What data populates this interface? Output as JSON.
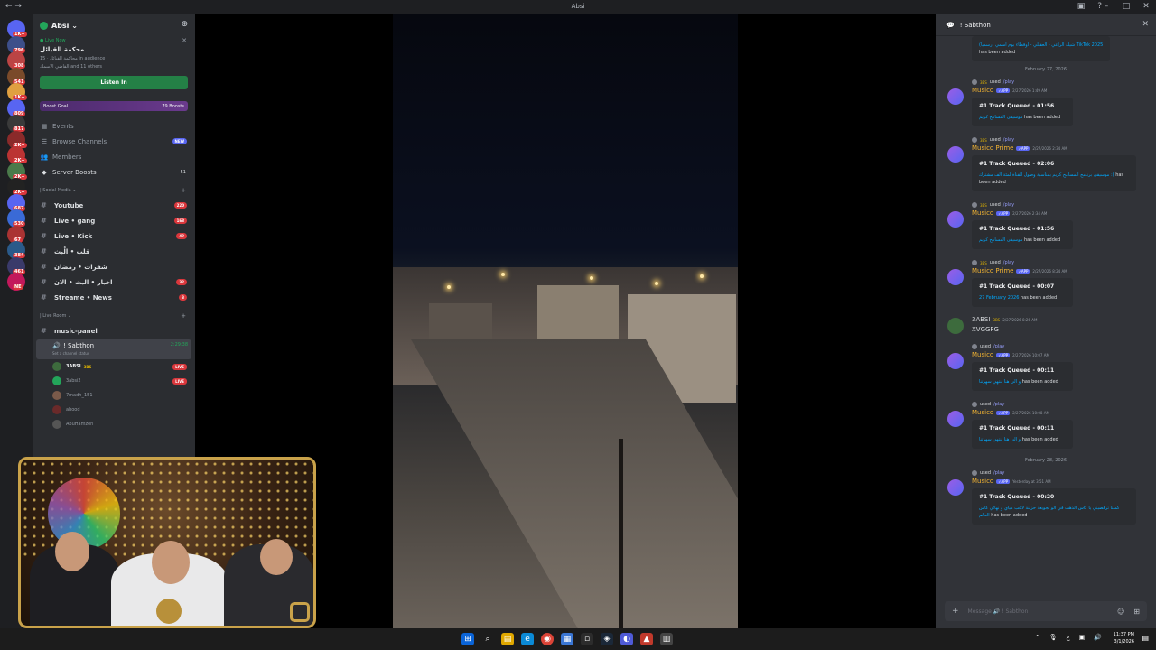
{
  "window": {
    "title": "Absi"
  },
  "server": {
    "name": "Absi ⌄",
    "live": {
      "label": "Live Now",
      "stage_name": "محكمة القبائل",
      "meta": "محاكمة القبائل · 15 in audience",
      "others": "القاضي الاسمك and 11 others",
      "button": "Listen In"
    },
    "boost": {
      "label": "Boost Goal",
      "count": "79 Boosts"
    },
    "nav": [
      {
        "label": "Events",
        "icon": "calendar-icon"
      },
      {
        "label": "Browse Channels",
        "icon": "browse-icon",
        "pill": "NEW"
      },
      {
        "label": "Members",
        "icon": "members-icon"
      },
      {
        "label": "Server Boosts",
        "icon": "boost-icon",
        "count": "51"
      }
    ],
    "categories": [
      {
        "name": "| Social Media ⌄",
        "channels": [
          {
            "name": "Youtube",
            "count": "220"
          },
          {
            "name": "Live • gang",
            "count": "168"
          },
          {
            "name": "Live • Kick",
            "count": "42"
          },
          {
            "name": "قلب • الْبث",
            "count": ""
          },
          {
            "name": "شقرات • رمضان",
            "count": ""
          },
          {
            "name": "اخبار • البث • الان",
            "count": "32"
          },
          {
            "name": "Streame • News",
            "count": "3"
          }
        ]
      },
      {
        "name": "| Live Room ⌄",
        "channels": [
          {
            "name": "music-panel",
            "count": ""
          }
        ]
      }
    ],
    "voice": {
      "name": "! Sabthon",
      "time": "2:29:38",
      "status": "Set a channel status",
      "members": [
        {
          "name": "3ABSI",
          "tag": "3BS",
          "live": "LIVE",
          "bold": true
        },
        {
          "name": "3absi2",
          "live": "LIVE",
          "bold": false
        },
        {
          "name": "7madh_151",
          "live": "",
          "bold": false
        },
        {
          "name": "abood",
          "live": "",
          "bold": false
        },
        {
          "name": "AbuHamzeh",
          "live": "",
          "bold": false
        }
      ]
    }
  },
  "rail": {
    "badges": [
      "1K+",
      "796",
      "308",
      "541",
      "1K+",
      "809",
      "817",
      "2K+",
      "2K+",
      "2K+",
      "2K+",
      "687",
      "530",
      "67",
      "384",
      "461",
      "NE"
    ]
  },
  "chat": {
    "title": "! Sabthon",
    "input_placeholder": "Message 🔊 ! Sabthon",
    "top_embed": {
      "text": "شيلة الراعي - العقيلي - اوقطاء بوم اسمي (رسمياً) TikTok 2025",
      "added": "has been added"
    },
    "messages": [
      {
        "date": "February 27, 2026",
        "used_tag": "3BS",
        "cmd": "/play",
        "author": "Musico",
        "time": "2/27/2026 1:49 AM",
        "queued": "#1 Track Queued - 01:56",
        "track": "موسيقى المسامح كريم",
        "added": "has been added"
      },
      {
        "date": "",
        "used_tag": "3BS",
        "cmd": "/play",
        "author": "Musico Prime",
        "time": "2/27/2026 2:34 AM",
        "queued": "#1 Track Queued - 02:06",
        "track": "موسيقى برنامج المسامح كريم بمناسبة وصول القناة لمئة الف مشترك :(",
        "added": "has been added"
      },
      {
        "date": "",
        "used_tag": "3BS",
        "cmd": "/play",
        "author": "Musico",
        "time": "2/27/2026 2:34 AM",
        "queued": "#1 Track Queued - 01:56",
        "track": "موسيقى المسامح كريم",
        "added": "has been added"
      },
      {
        "date": "",
        "used_tag": "3BS",
        "cmd": "/play",
        "author": "Musico Prime",
        "time": "2/27/2026 8:24 AM",
        "queued": "#1 Track Queued - 00:07",
        "track": "27 February 2026",
        "added": "has been added"
      }
    ],
    "plain": {
      "author": "3ABSI",
      "tag": "3BS",
      "time": "2/27/2026 8:26 AM",
      "body": "XVGGFG"
    },
    "messages2": [
      {
        "date": "",
        "used_tag": "",
        "cmd": "/play",
        "author": "Musico",
        "time": "2/27/2026 10:07 AM",
        "queued": "#1 Track Queued - 00:11",
        "track": "و الى هنا تنتهي سهرتنا",
        "added": "has been added"
      },
      {
        "date": "",
        "used_tag": "",
        "cmd": "/play",
        "author": "Musico",
        "time": "2/27/2026 10:08 AM",
        "queued": "#1 Track Queued - 00:11",
        "track": "و الى هنا تنتهي سهرتنا",
        "added": "has been added"
      },
      {
        "date": "February 28, 2026",
        "used_tag": "",
        "cmd": "/play",
        "author": "Musico",
        "time": "Yesterday at 3:51 AM",
        "queued": "#1 Track Queued - 00:20",
        "track": "كملنا ترقصيني يا كاس الذهب في الو تجويعة حزينة لا‌‌عب مياي و نهائي كاس العالم",
        "added": "has been added"
      }
    ]
  },
  "taskbar": {
    "clock_time": "11:37 PM",
    "clock_date": "3/1/2026",
    "lang": "ع"
  }
}
